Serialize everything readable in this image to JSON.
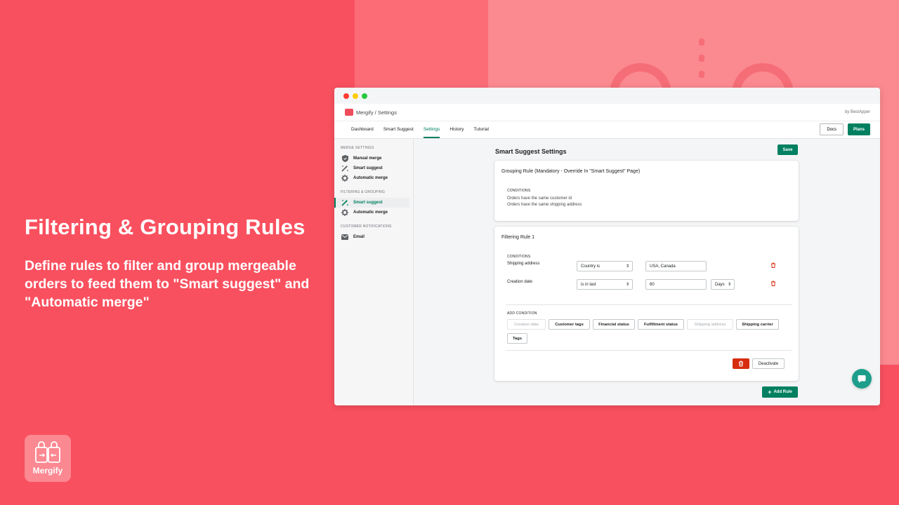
{
  "colors": {
    "background": "#f9505f",
    "accent": "#008060",
    "danger": "#d72c0d",
    "chat": "#1d9e8b"
  },
  "hero": {
    "title": "Filtering & Grouping Rules",
    "description": "Define rules to filter and group mergeable orders to feed them to \"Smart suggest\" and \"Automatic merge\""
  },
  "brand": {
    "name": "Mergify",
    "icon": "shopping-bags-icon"
  },
  "app": {
    "breadcrumb": "Mergify / Settings",
    "by_text": "by BestApper",
    "nav": {
      "tabs": [
        {
          "label": "Dashboard"
        },
        {
          "label": "Smart Suggest"
        },
        {
          "label": "Settings",
          "active": true
        },
        {
          "label": "History"
        },
        {
          "label": "Tutorial"
        }
      ],
      "docs_label": "Docs",
      "plans_label": "Plans"
    },
    "sidebar": {
      "sections": [
        {
          "heading": "MERGE SETTINGS",
          "items": [
            {
              "label": "Manual merge",
              "icon": "shield-icon"
            },
            {
              "label": "Smart suggest",
              "icon": "magic-wand-icon"
            },
            {
              "label": "Automatic merge",
              "icon": "gear-icon"
            }
          ]
        },
        {
          "heading": "FILTERING & GROUPING",
          "items": [
            {
              "label": "Smart suggest",
              "icon": "magic-wand-icon",
              "active": true
            },
            {
              "label": "Automatic merge",
              "icon": "gear-icon"
            }
          ]
        },
        {
          "heading": "CUSTOMER NOTIFICATIONS",
          "items": [
            {
              "label": "Email",
              "icon": "envelope-icon"
            }
          ]
        }
      ]
    },
    "main": {
      "title": "Smart Suggest Settings",
      "save_label": "Save",
      "grouping_rule": {
        "title": "Grouping Rule (Mandatory - Override In \"Smart Suggest\" Page)",
        "conditions_label": "CONDITIONS",
        "conditions": [
          "Orders have the same customer id",
          "Orders have the same shipping address"
        ]
      },
      "filtering_rule": {
        "title": "Filtering Rule 1",
        "conditions_label": "CONDITIONS",
        "conditions": [
          {
            "field": "Shipping address",
            "operator": "Country is",
            "value": "USA, Canada"
          },
          {
            "field": "Creation date",
            "operator": "is in last",
            "value": "60",
            "unit": "Days"
          }
        ],
        "add_condition_label": "ADD CONDITION",
        "add_options": [
          {
            "label": "Creation date",
            "disabled": true
          },
          {
            "label": "Customer tags",
            "disabled": false
          },
          {
            "label": "Financial status",
            "disabled": false
          },
          {
            "label": "Fulfillment status",
            "disabled": false
          },
          {
            "label": "Shipping address",
            "disabled": true
          },
          {
            "label": "Shipping carrier",
            "disabled": false
          },
          {
            "label": "Tags",
            "disabled": false
          }
        ],
        "deactivate_label": "Deactivate"
      },
      "add_rule_label": "Add Rule"
    }
  }
}
